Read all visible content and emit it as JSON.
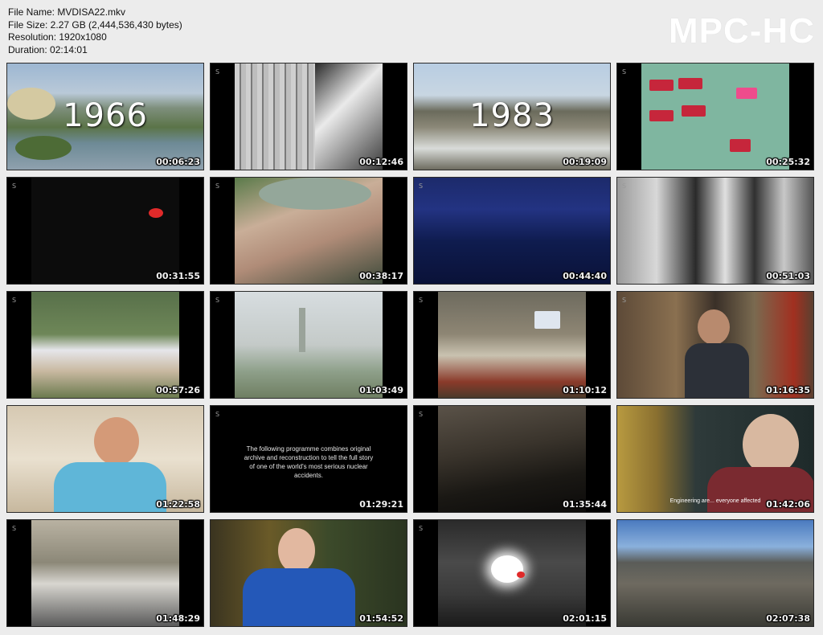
{
  "file_info": {
    "name_line": "File Name: MVDISA22.mkv",
    "size_line": "File Size: 2.27 GB (2,444,536,430 bytes)",
    "resolution_line": "Resolution: 1920x1080",
    "duration_line": "Duration: 02:14:01"
  },
  "logo": "MPC-HC",
  "channel_mark": "S",
  "thumbnails": [
    {
      "time": "00:06:23",
      "overlay": "1966"
    },
    {
      "time": "00:12:46"
    },
    {
      "time": "00:19:09",
      "overlay": "1983"
    },
    {
      "time": "00:25:32"
    },
    {
      "time": "00:31:55"
    },
    {
      "time": "00:38:17"
    },
    {
      "time": "00:44:40"
    },
    {
      "time": "00:51:03"
    },
    {
      "time": "00:57:26"
    },
    {
      "time": "01:03:49"
    },
    {
      "time": "01:10:12"
    },
    {
      "time": "01:16:35"
    },
    {
      "time": "01:22:58"
    },
    {
      "time": "01:29:21",
      "caption": "The following programme combines original archive and reconstruction to tell the full story of one of the world's most serious nuclear accidents."
    },
    {
      "time": "01:35:44"
    },
    {
      "time": "01:42:06",
      "subtitle": "Engineering are... everyone affected"
    },
    {
      "time": "01:48:29"
    },
    {
      "time": "01:54:52"
    },
    {
      "time": "02:01:15"
    },
    {
      "time": "02:07:38"
    }
  ]
}
